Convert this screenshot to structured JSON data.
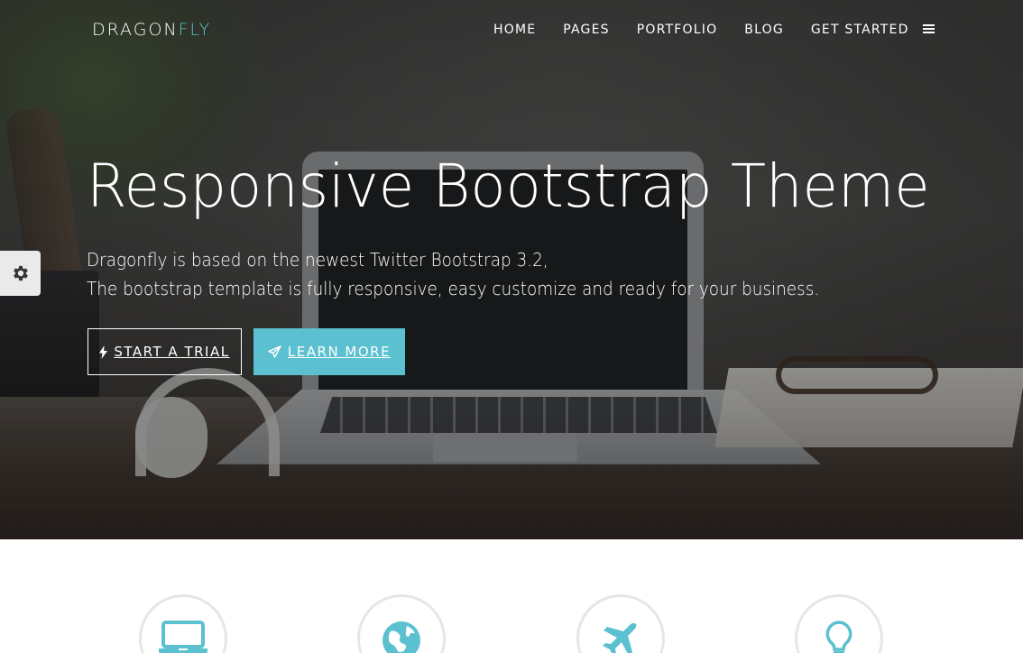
{
  "brand": {
    "part1": "DRAGON",
    "part2": "FLY"
  },
  "nav": {
    "items": [
      {
        "label": "HOME"
      },
      {
        "label": "PAGES"
      },
      {
        "label": "PORTFOLIO"
      },
      {
        "label": "BLOG"
      },
      {
        "label": "GET STARTED"
      }
    ],
    "menu_icon": "bars-icon"
  },
  "settings": {
    "icon": "gear-icon"
  },
  "hero": {
    "title": "Responsive Bootstrap Theme",
    "subtitle_line1": "Dragonfly is based on the newest Twitter Bootstrap 3.2,",
    "subtitle_line2": "The bootstrap template is fully responsive, easy customize and ready for your business.",
    "buttons": [
      {
        "label": "START A TRIAL",
        "icon": "bolt-icon"
      },
      {
        "label": "LEARN MORE",
        "icon": "paper-plane-icon"
      }
    ]
  },
  "features": [
    {
      "icon": "laptop-icon"
    },
    {
      "icon": "globe-icon"
    },
    {
      "icon": "plane-icon"
    },
    {
      "icon": "lightbulb-icon"
    }
  ],
  "colors": {
    "accent": "#5bc0cf",
    "icon_teal": "#5bc0cf",
    "circle_border": "#e6e6e6"
  }
}
